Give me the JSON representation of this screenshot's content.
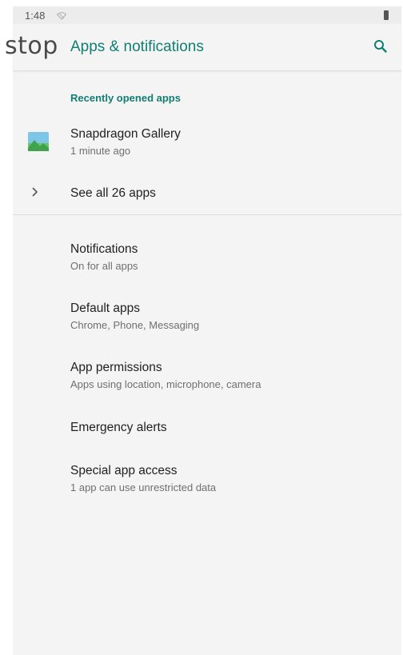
{
  "overlay": {
    "text": "stop"
  },
  "status_bar": {
    "time": "1:48"
  },
  "app_bar": {
    "title": "Apps & notifications"
  },
  "recent": {
    "header": "Recently opened apps",
    "apps": [
      {
        "name": "Snapdragon Gallery",
        "time": "1 minute ago"
      }
    ],
    "see_all": "See all 26 apps"
  },
  "settings": [
    {
      "title": "Notifications",
      "subtitle": "On for all apps"
    },
    {
      "title": "Default apps",
      "subtitle": "Chrome, Phone, Messaging"
    },
    {
      "title": "App permissions",
      "subtitle": "Apps using location, microphone, camera"
    },
    {
      "title": "Emergency alerts",
      "subtitle": ""
    },
    {
      "title": "Special app access",
      "subtitle": "1 app can use unrestricted data"
    }
  ],
  "colors": {
    "accent": "#117e73",
    "background": "#f4f4f4",
    "status_bar": "#ececec"
  }
}
